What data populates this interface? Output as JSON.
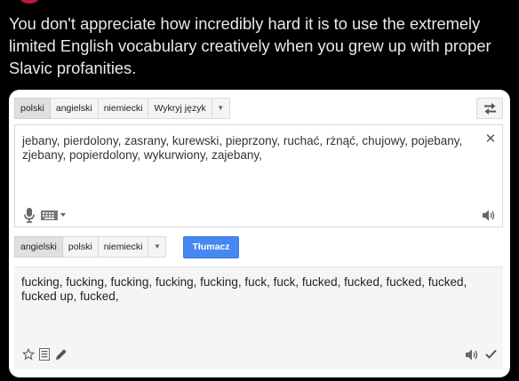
{
  "post": {
    "caption": "You don't appreciate how incredibly hard it is to use the extremely limited English vocabulary creatively when you grew up with proper Slavic profanities."
  },
  "translator": {
    "source_langs": [
      "polski",
      "angielski",
      "niemiecki",
      "Wykryj język"
    ],
    "source_active_index": 0,
    "source_text": "jebany, pierdolony, zasrany, kurewski, pieprzony, ruchać, rżnąć, chujowy, pojebany, zjebany, popierdolony, wykurwiony, zajebany,",
    "target_langs": [
      "angielski",
      "polski",
      "niemiecki"
    ],
    "target_active_index": 0,
    "translate_label": "Tłumacz",
    "result_text": "fucking, fucking, fucking, fucking, fucking, fuck, fuck, fucked, fucked, fucked, fucked, fucked up, fucked,",
    "colors": {
      "accent": "#4787f1",
      "background": "#000000",
      "caption": "#e7e9ea"
    },
    "icons": [
      "swap-languages-icon",
      "clear-icon",
      "microphone-icon",
      "keyboard-icon",
      "chevron-down-icon",
      "speaker-icon",
      "star-icon",
      "phrasebook-icon",
      "edit-pencil-icon",
      "checkmark-icon"
    ]
  }
}
